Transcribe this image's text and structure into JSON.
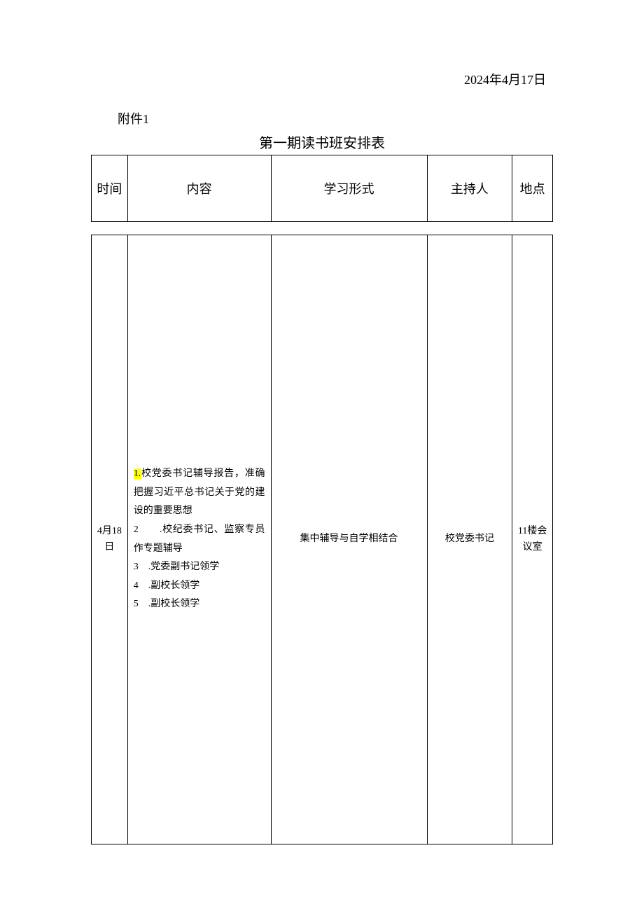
{
  "date": "2024年4月17日",
  "attachment_label": "附件1",
  "table_title": "第一期读书班安排表",
  "headers": {
    "time": "时间",
    "content": "内容",
    "format": "学习形式",
    "host": "主持人",
    "location": "地点"
  },
  "row": {
    "time": "4月18日",
    "content": {
      "item1_prefix": "1.",
      "item1_text": "校党委书记辅导报告，准确把握习近平总书记关于党的建设的重要思想",
      "item2": "2　　.校纪委书记、监察专员作专题辅导",
      "item3": "3　.党委副书记领学",
      "item4": "4　.副校长领学",
      "item5": "5　.副校长领学"
    },
    "format": "集中辅导与自学相结合",
    "host": "校党委书记",
    "location": "11楼会议室"
  }
}
